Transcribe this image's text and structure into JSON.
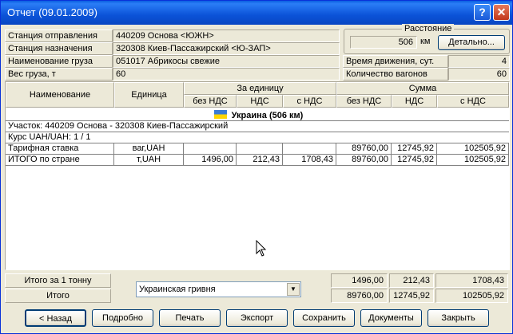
{
  "window": {
    "title": "Отчет (09.01.2009)"
  },
  "info": {
    "departure_label": "Станция отправления",
    "departure_value": "440209  Основа <ЮЖН>",
    "destination_label": "Станция назначения",
    "destination_value": "320308  Киев-Пассажирский <Ю-ЗАП>",
    "cargo_label": "Наименование груза",
    "cargo_value": "051017 Абрикосы свежие",
    "weight_label": "Вес груза, т",
    "weight_value": "60"
  },
  "distance": {
    "group_label": "Расстояние",
    "value": "506",
    "unit": "км",
    "details_button": "Детально..."
  },
  "travel": {
    "time_label": "Время движения, сут.",
    "time_value": "4",
    "wagons_label": "Количество вагонов",
    "wagons_value": "60"
  },
  "table": {
    "headers": {
      "name": "Наименование",
      "unit": "Единица",
      "per_unit": "За единицу",
      "sum": "Сумма",
      "no_vat": "без НДС",
      "vat": "НДС",
      "with_vat": "с НДС"
    },
    "country": "Украина (506 км)",
    "section": "Участок: 440209  Основа - 320308  Киев-Пассажирский",
    "rate": "Курс UAH/UAH: 1 / 1",
    "rows": [
      {
        "name": "Тарифная ставка",
        "unit": "ваг,UAH",
        "u_novat": "",
        "u_vat": "",
        "u_withvat": "",
        "s_novat": "89760,00",
        "s_vat": "12745,92",
        "s_withvat": "102505,92"
      },
      {
        "name": "ИТОГО по стране",
        "unit": "т,UAH",
        "u_novat": "1496,00",
        "u_vat": "212,43",
        "u_withvat": "1708,43",
        "s_novat": "89760,00",
        "s_vat": "12745,92",
        "s_withvat": "102505,92"
      }
    ]
  },
  "totals": {
    "per_ton_label": "Итого за 1 тонну",
    "total_label": "Итого",
    "currency": "Украинская гривня",
    "per_ton": [
      "1496,00",
      "212,43",
      "1708,43"
    ],
    "total": [
      "89760,00",
      "12745,92",
      "102505,92"
    ]
  },
  "buttons": {
    "back": "< Назад",
    "details": "Подробно",
    "print": "Печать",
    "export": "Экспорт",
    "save": "Сохранить",
    "documents": "Документы",
    "close": "Закрыть"
  },
  "colors": {
    "flag_top": "#3a7bd5",
    "flag_bottom": "#ffd500",
    "titlebar": "#0b53d8"
  }
}
